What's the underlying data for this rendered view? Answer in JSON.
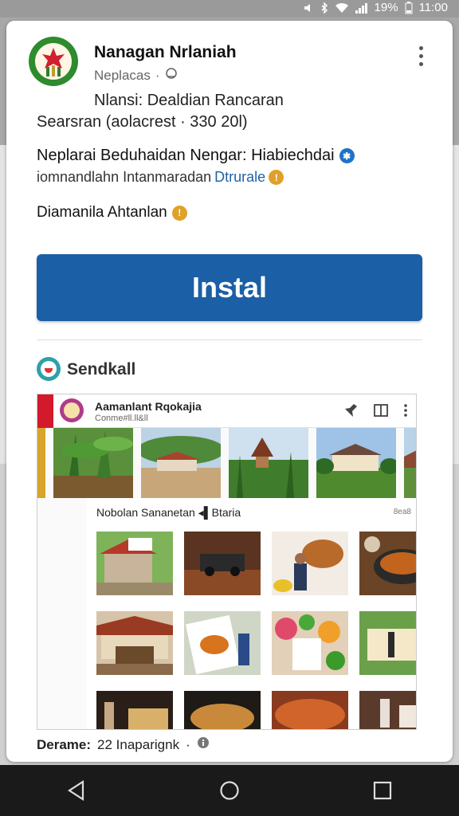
{
  "status_bar": {
    "battery": "19%",
    "time": "11:00"
  },
  "app": {
    "title": "Nanagan Nrlaniah",
    "subtitle": "Neplacas",
    "line1": "Nlansi: Dealdian Rancaran",
    "line2": "Searsran (aolacrest · 330 20l)",
    "line3": "Neplarai Beduhaidan Nengar: Hiabiechdai",
    "line4_text": "iomnandlahn Intanmaradan",
    "line4_link": "Dtrurale",
    "line5": "Diamanila Ahtanlan"
  },
  "install_button": {
    "label": "Instal"
  },
  "section": {
    "title": "Sendkall"
  },
  "preview": {
    "title": "Aamanlant Rqokajia",
    "subtitle": "Conme#ll.ll&ll",
    "gallery_title": "Nobolan Sananetan ◂▌Btaria",
    "gallery_count": "8ea8"
  },
  "footer": {
    "label": "Derame:",
    "value": "22 Inaparignk"
  },
  "colors": {
    "install_button": "#1b5fa6",
    "link": "#1f63a8",
    "app_logo": "#2e8b2e",
    "preview_accent": "#d31a2c"
  },
  "icons": [
    "signal-icon",
    "bluetooth-icon",
    "wifi-icon",
    "battery-icon",
    "kebab-menu-icon",
    "globe-icon",
    "verified-gear-icon",
    "emoji-icon",
    "pin-icon",
    "book-icon",
    "back-icon",
    "home-icon",
    "recents-icon"
  ]
}
